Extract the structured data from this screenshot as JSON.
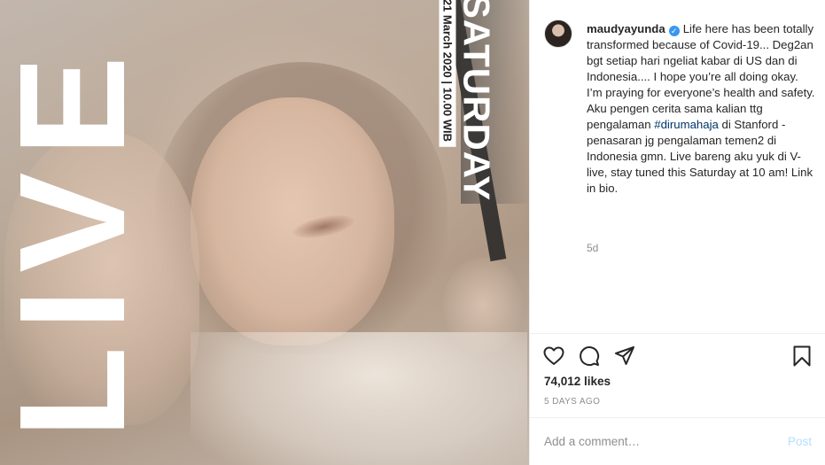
{
  "post": {
    "image_overlay": {
      "live_word": "LIVE",
      "day": "SATURDAY",
      "date_time": "21 March 2020 | 10.00 WIB"
    },
    "username": "maudyayunda",
    "verified": true,
    "caption_lines": [
      "Life here has been totally transformed because of Covid-19... Deg2an bgt setiap hari ngeliat kabar di US dan di Indonesia.... I hope you’re all doing okay.",
      "I’m praying for everyone’s health and safety."
    ],
    "caption_tail_before_tag": "Aku pengen cerita sama kalian ttg pengalaman ",
    "hashtag": "#dirumahaja",
    "caption_tail_after_tag": " di Stanford - penasaran jg pengalaman temen2 di Indonesia gmn. Live bareng aku yuk di V-live, stay tuned this Saturday at 10 am! Link in bio.",
    "time_ago": "5d",
    "likes": "74,012 likes",
    "date_label": "5 DAYS AGO",
    "comment_placeholder": "Add a comment…",
    "post_label": "Post"
  },
  "icons": {
    "like": "heart-icon",
    "comment": "comment-icon",
    "share": "share-icon",
    "save": "bookmark-icon",
    "verified": "verified-badge-icon"
  },
  "colors": {
    "verified_blue": "#3897f0",
    "hashtag": "#003569",
    "post_disabled": "#b2dffc",
    "muted": "#8e8e8e"
  }
}
